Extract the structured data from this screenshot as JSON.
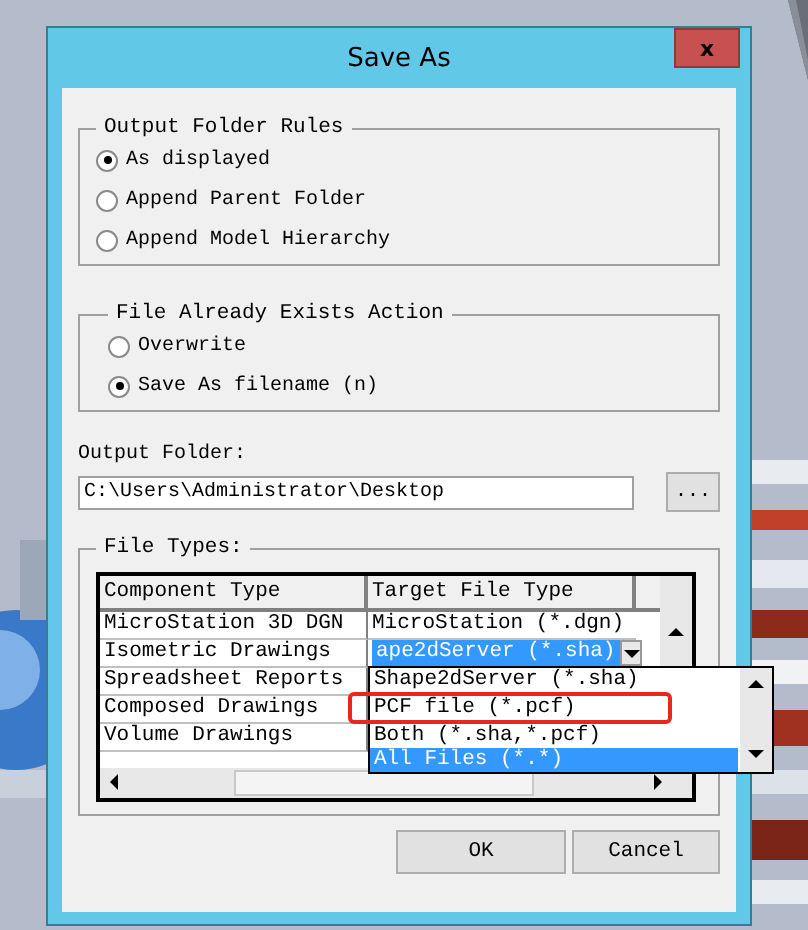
{
  "window": {
    "title": "Save As",
    "close": "x"
  },
  "output_folder_rules": {
    "title": "Output Folder Rules",
    "options": [
      {
        "label": "As displayed",
        "selected": true
      },
      {
        "label": "Append Parent Folder",
        "selected": false
      },
      {
        "label": "Append Model Hierarchy",
        "selected": false
      }
    ]
  },
  "file_exists_action": {
    "title": "File Already Exists Action",
    "options": [
      {
        "label": "Overwrite",
        "selected": false
      },
      {
        "label": "Save As filename (n)",
        "selected": true
      }
    ]
  },
  "output_folder": {
    "label": "Output Folder:",
    "value": "C:\\Users\\Administrator\\Desktop",
    "browse_button": "..."
  },
  "file_types": {
    "title": "File Types:",
    "columns": [
      "Component Type",
      "Target File Type"
    ],
    "rows": [
      {
        "component": "MicroStation 3D DGN",
        "kind": "text",
        "target": "MicroStation (*.dgn)"
      },
      {
        "component": "Isometric Drawings",
        "kind": "combo",
        "target": "ape2dServer (*.sha)"
      },
      {
        "component": "Spreadsheet Reports",
        "kind": "none"
      },
      {
        "component": "Composed Drawings",
        "kind": "none"
      },
      {
        "component": "Volume Drawings",
        "kind": "none"
      }
    ],
    "dropdown_list": [
      {
        "label": "Shape2dServer (*.sha)",
        "selected": false,
        "highlighted": false
      },
      {
        "label": "PCF file (*.pcf)",
        "selected": false,
        "highlighted": true
      },
      {
        "label": "Both (*.sha,*.pcf)",
        "selected": false,
        "highlighted": false
      },
      {
        "label": "All Files (*.*)",
        "selected": true,
        "highlighted": false
      }
    ]
  },
  "buttons": [
    "OK",
    "Cancel"
  ]
}
